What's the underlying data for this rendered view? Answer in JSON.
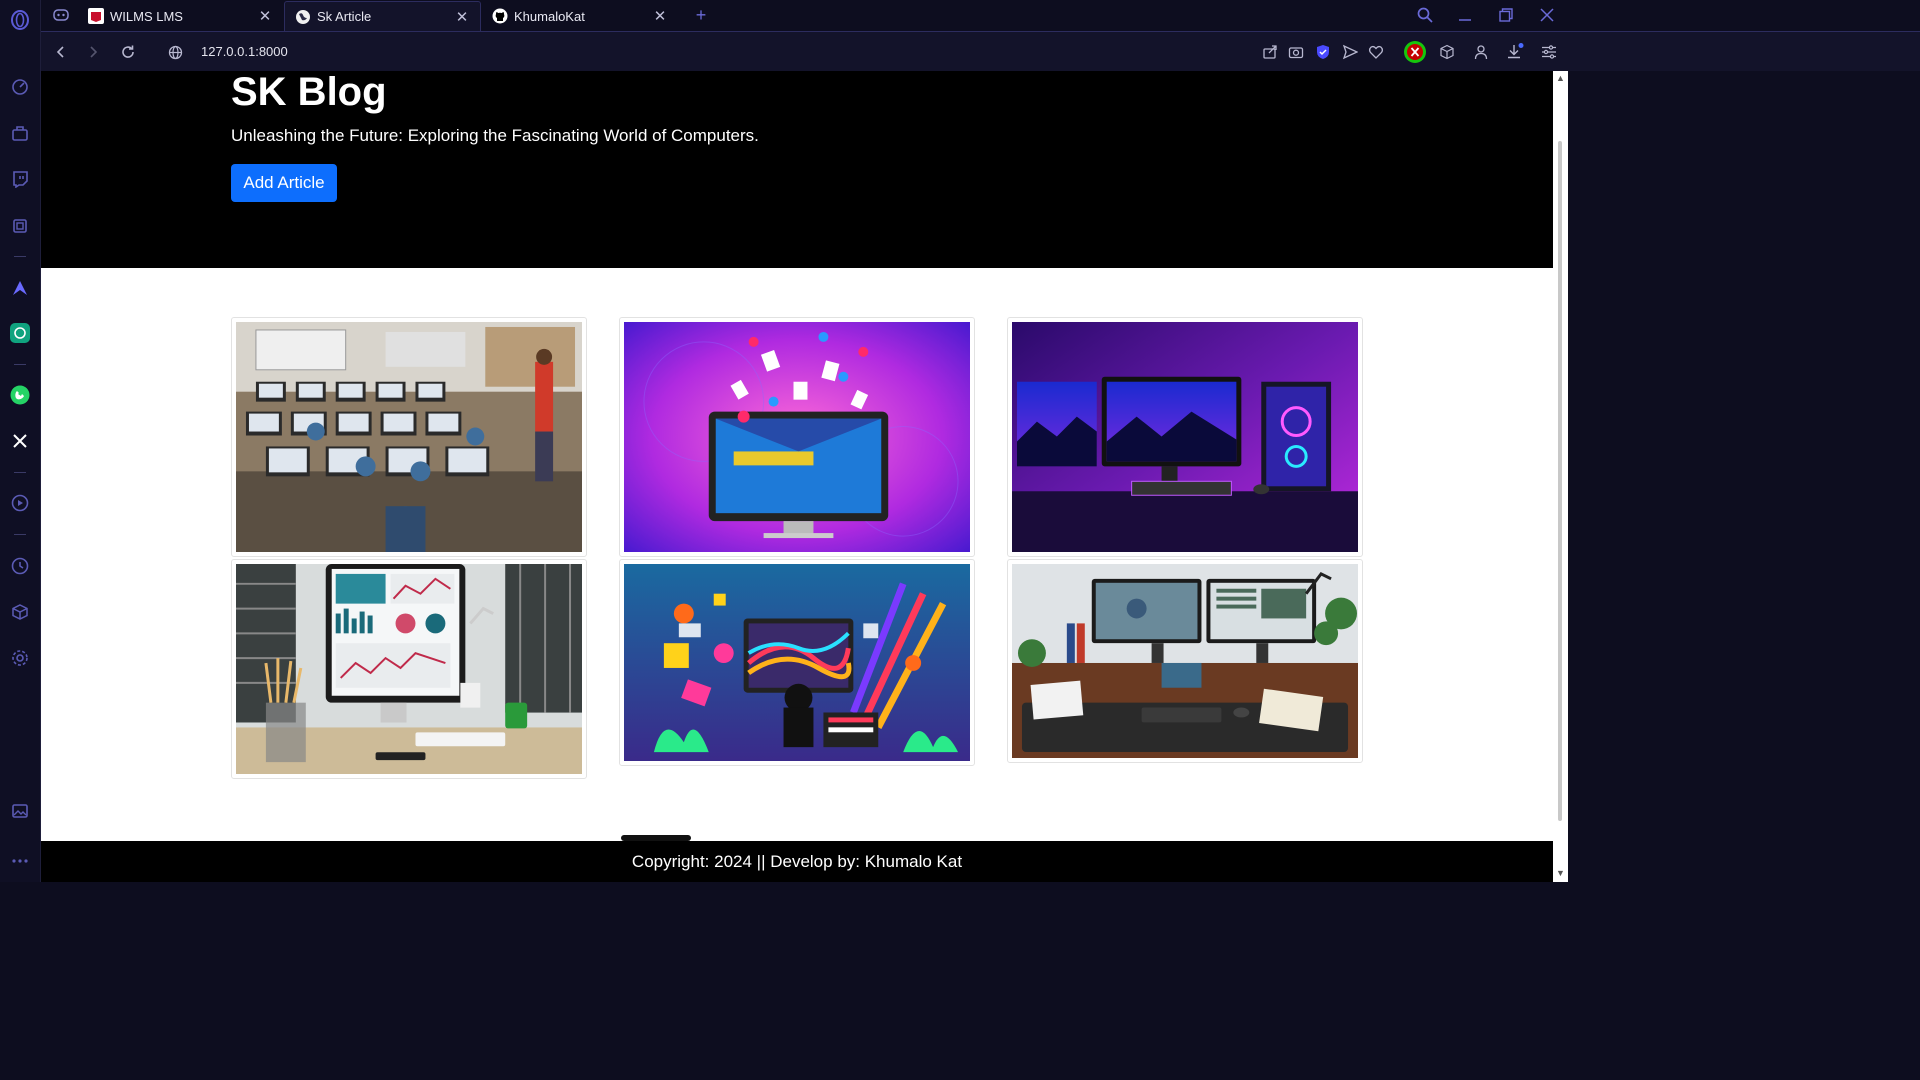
{
  "browser": {
    "tabs": [
      {
        "title": "WILMS LMS",
        "active": false
      },
      {
        "title": "Sk Article",
        "active": true
      },
      {
        "title": "KhumaloKat",
        "active": false
      }
    ],
    "new_tab_label": "+",
    "url": "127.0.0.1:8000",
    "colors": {
      "frame": "#0d0d1f",
      "accent": "#4a4aff",
      "profile_ring": "#16c60c"
    }
  },
  "sidebar": {
    "icons": [
      "opera-logo-icon",
      "speed-dial-icon",
      "bag-icon",
      "twitch-icon",
      "ai-chip-icon",
      "aria-icon",
      "chatgpt-icon",
      "whatsapp-icon",
      "x-icon",
      "player-icon",
      "history-icon",
      "cube-icon",
      "settings-icon",
      "gallery-icon",
      "more-icon"
    ]
  },
  "page": {
    "title": "SK Blog",
    "subtitle": "Unleashing the Future: Exploring the Fascinating World of Computers.",
    "add_button": "Add Article",
    "articles": [
      {
        "image": "classroom-computers-photo"
      },
      {
        "image": "digital-monitor-illustration"
      },
      {
        "image": "purple-gaming-setup-photo"
      },
      {
        "image": "analytics-desktop-photo"
      },
      {
        "image": "colorful-creative-desk-illustration"
      },
      {
        "image": "home-office-desk-photo"
      }
    ],
    "footer": "Copyright: 2024 || Develop by: Khumalo Kat",
    "colors": {
      "hero_bg": "#000000",
      "button_bg": "#0d6efd"
    }
  }
}
